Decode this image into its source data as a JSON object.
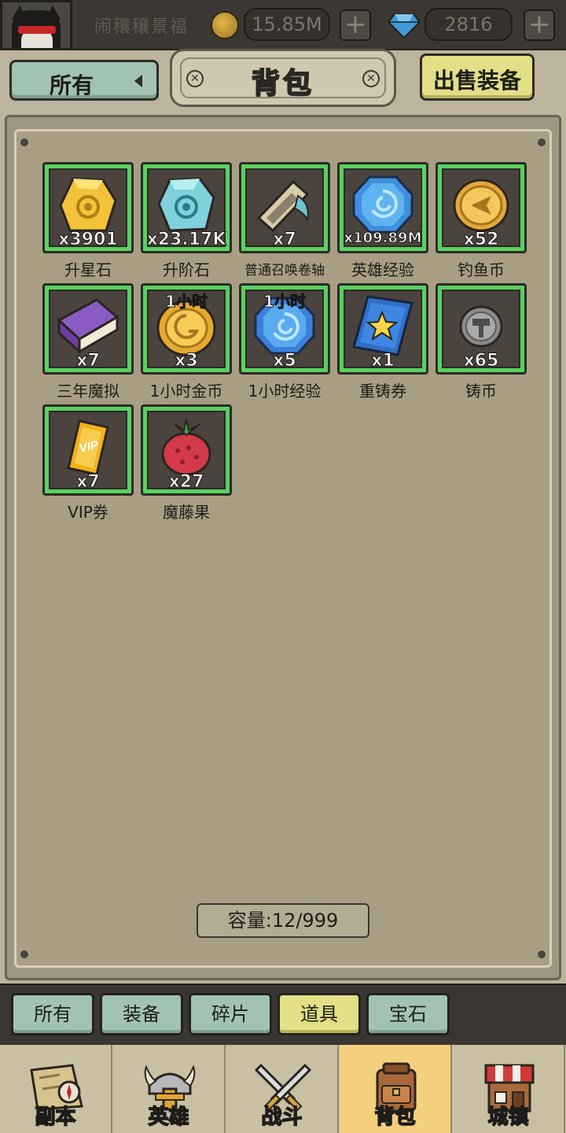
{
  "topbar": {
    "player_name": "闹穰穰景福",
    "gold": "15.85M",
    "gems": "2816",
    "plus": "+"
  },
  "header": {
    "filter_label": "所有",
    "title": "背包",
    "sell_label": "出售装备"
  },
  "items": [
    {
      "name": "升星石",
      "qty": "x3901",
      "tag": "",
      "icon": "gold-rune-stone-icon"
    },
    {
      "name": "升阶石",
      "qty": "x23.17K",
      "tag": "",
      "icon": "teal-rune-stone-icon"
    },
    {
      "name": "普通召唤卷轴",
      "qty": "x7",
      "tag": "",
      "icon": "summon-scroll-icon"
    },
    {
      "name": "英雄经验",
      "qty": "x109.89M",
      "tag": "",
      "icon": "blue-exp-gem-icon"
    },
    {
      "name": "钓鱼币",
      "qty": "x52",
      "tag": "",
      "icon": "fishing-coin-icon"
    },
    {
      "name": "三年魔拟",
      "qty": "x7",
      "tag": "",
      "icon": "purple-book-icon"
    },
    {
      "name": "1小时金币",
      "qty": "x3",
      "tag": "1小时",
      "icon": "hour-gold-coin-icon"
    },
    {
      "name": "1小时经验",
      "qty": "x5",
      "tag": "1小时",
      "icon": "hour-exp-gem-icon"
    },
    {
      "name": "重铸券",
      "qty": "x1",
      "tag": "",
      "icon": "reforge-ticket-icon"
    },
    {
      "name": "铸币",
      "qty": "x65",
      "tag": "",
      "icon": "hammer-coin-icon"
    },
    {
      "name": "VIP券",
      "qty": "x7",
      "tag": "",
      "icon": "vip-ticket-icon"
    },
    {
      "name": "魔藤果",
      "qty": "x27",
      "tag": "",
      "icon": "berry-fruit-icon"
    }
  ],
  "capacity": "容量:12/999",
  "categories": [
    {
      "label": "所有",
      "active": false
    },
    {
      "label": "装备",
      "active": false
    },
    {
      "label": "碎片",
      "active": false
    },
    {
      "label": "道具",
      "active": true
    },
    {
      "label": "宝石",
      "active": false
    }
  ],
  "nav": [
    {
      "label": "副本",
      "active": false,
      "icon": "map-compass-icon"
    },
    {
      "label": "英雄",
      "active": false,
      "icon": "viking-helmet-icon"
    },
    {
      "label": "战斗",
      "active": false,
      "icon": "crossed-swords-icon"
    },
    {
      "label": "背包",
      "active": true,
      "icon": "backpack-icon"
    },
    {
      "label": "城镇",
      "active": false,
      "icon": "shop-building-icon"
    }
  ],
  "colors": {
    "slot_border_green": "#5ad160",
    "tab_teal": "#a3c3b2",
    "tab_active_yellow": "#e2df86",
    "nav_active": "#f4cf7d",
    "panel_bg": "#a89e83"
  }
}
